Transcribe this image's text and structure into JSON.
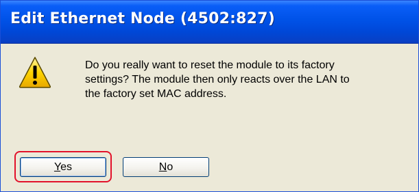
{
  "dialog": {
    "title": "Edit Ethernet Node (4502:827)",
    "icon": "warning-icon",
    "message": "Do you really want to reset the module to its factory\nsettings? The module then only reacts over the LAN to\nthe factory set MAC address."
  },
  "buttons": {
    "yes": {
      "mnemonic": "Y",
      "rest": "es"
    },
    "no": {
      "mnemonic": "N",
      "rest": "o"
    }
  },
  "colors": {
    "title_bar": "#0052e8",
    "dialog_bg": "#ece9d8",
    "highlight": "#e2112a",
    "warning_fill": "#ffd400"
  }
}
